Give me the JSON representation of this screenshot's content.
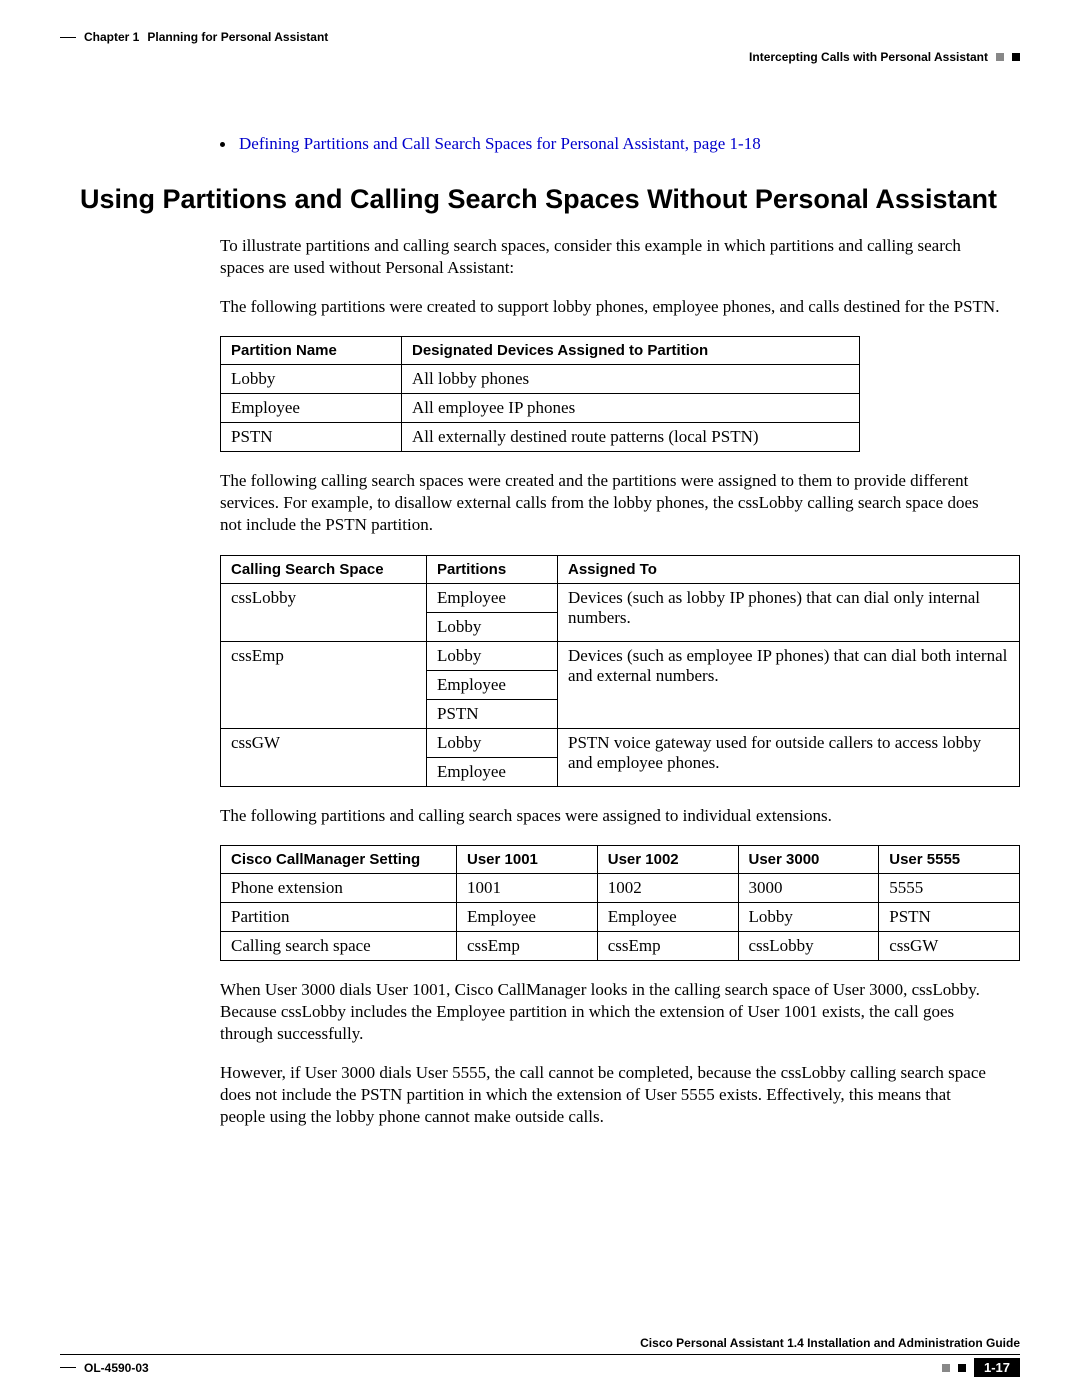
{
  "header": {
    "chapter": "Chapter 1",
    "chapter_title": "Planning for Personal Assistant",
    "section_title": "Intercepting Calls with Personal Assistant"
  },
  "bullet_link": "Defining Partitions and Call Search Spaces for Personal Assistant, page 1-18",
  "heading": "Using Partitions and Calling Search Spaces Without Personal Assistant",
  "para1": "To illustrate partitions and calling search spaces, consider this example in which partitions and calling search spaces are used without Personal Assistant:",
  "para2": "The following partitions were created to support lobby phones, employee phones, and calls destined for the PSTN.",
  "table1": {
    "h1": "Partition Name",
    "h2": "Designated Devices Assigned to Partition",
    "rows": [
      {
        "c1": "Lobby",
        "c2": "All lobby phones"
      },
      {
        "c1": "Employee",
        "c2": "All employee IP phones"
      },
      {
        "c1": "PSTN",
        "c2": "All externally destined route patterns (local PSTN)"
      }
    ]
  },
  "para3": "The following calling search spaces were created and the partitions were assigned to them to provide different services. For example, to disallow external calls from the lobby phones, the cssLobby calling search space does not include the PSTN partition.",
  "table2": {
    "h1": "Calling Search Space",
    "h2": "Partitions",
    "h3": "Assigned To",
    "r1": {
      "css": "cssLobby",
      "p1": "Employee",
      "p2": "Lobby",
      "desc": "Devices (such as lobby IP phones) that can dial only internal numbers."
    },
    "r2": {
      "css": "cssEmp",
      "p1": "Lobby",
      "p2": "Employee",
      "p3": "PSTN",
      "desc": "Devices (such as employee IP phones) that can dial both internal and external numbers."
    },
    "r3": {
      "css": "cssGW",
      "p1": "Lobby",
      "p2": "Employee",
      "desc": "PSTN voice gateway used for outside callers to access lobby and employee phones."
    }
  },
  "para4": "The following partitions and calling search spaces were assigned to individual extensions.",
  "table3": {
    "h1": "Cisco CallManager Setting",
    "h2": "User 1001",
    "h3": "User 1002",
    "h4": "User 3000",
    "h5": "User 5555",
    "rows": [
      {
        "c1": "Phone extension",
        "c2": "1001",
        "c3": "1002",
        "c4": "3000",
        "c5": "5555"
      },
      {
        "c1": "Partition",
        "c2": "Employee",
        "c3": "Employee",
        "c4": "Lobby",
        "c5": "PSTN"
      },
      {
        "c1": "Calling search space",
        "c2": "cssEmp",
        "c3": "cssEmp",
        "c4": "cssLobby",
        "c5": "cssGW"
      }
    ]
  },
  "para5": "When User 3000 dials User 1001, Cisco CallManager looks in the calling search space of User 3000, cssLobby. Because cssLobby includes the Employee partition in which the extension of User 1001 exists, the call goes through successfully.",
  "para6": "However, if User 3000 dials User 5555, the call cannot be completed, because the cssLobby calling search space does not include the PSTN partition in which the extension of User 5555 exists. Effectively, this means that people using the lobby phone cannot make outside calls.",
  "footer": {
    "guide": "Cisco Personal Assistant 1.4 Installation and Administration Guide",
    "docid": "OL-4590-03",
    "pagenum": "1-17"
  }
}
